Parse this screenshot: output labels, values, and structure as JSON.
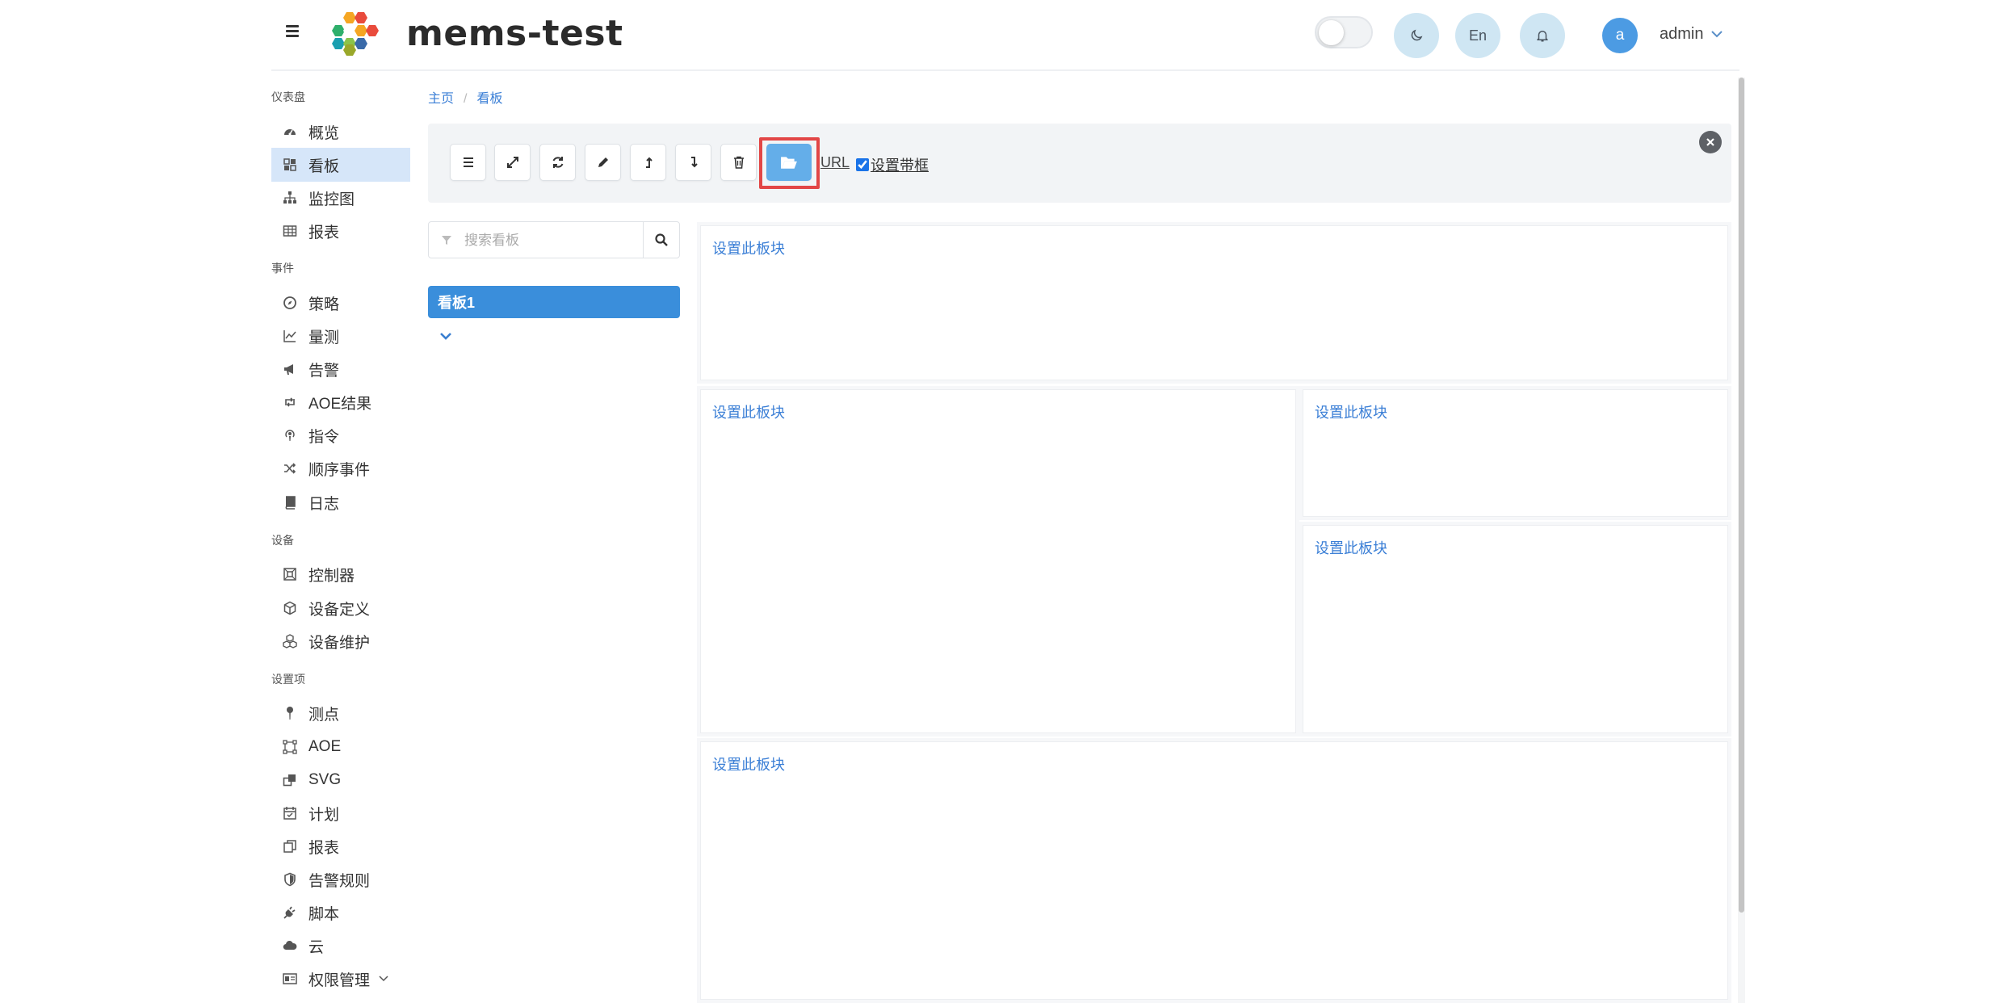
{
  "header": {
    "title": "mems-test",
    "lang_label": "En",
    "avatar_letter": "a",
    "user_name": "admin"
  },
  "sidebar": {
    "sections": [
      {
        "title": "仪表盘",
        "items": [
          {
            "label": "概览",
            "icon": "dashboard-icon"
          },
          {
            "label": "看板",
            "icon": "board-icon",
            "active": true
          },
          {
            "label": "监控图",
            "icon": "sitemap-icon"
          },
          {
            "label": "报表",
            "icon": "table-icon"
          }
        ]
      },
      {
        "title": "事件",
        "items": [
          {
            "label": "策略",
            "icon": "compass-icon"
          },
          {
            "label": "量测",
            "icon": "line-chart-icon"
          },
          {
            "label": "告警",
            "icon": "megaphone-icon"
          },
          {
            "label": "AOE结果",
            "icon": "retweet-icon"
          },
          {
            "label": "指令",
            "icon": "podcast-icon"
          },
          {
            "label": "顺序事件",
            "icon": "shuffle-icon"
          },
          {
            "label": "日志",
            "icon": "book-icon"
          }
        ]
      },
      {
        "title": "设备",
        "items": [
          {
            "label": "控制器",
            "icon": "controller-icon"
          },
          {
            "label": "设备定义",
            "icon": "cube-icon"
          },
          {
            "label": "设备维护",
            "icon": "cubes-icon"
          }
        ]
      },
      {
        "title": "设置项",
        "items": [
          {
            "label": "测点",
            "icon": "pin-icon"
          },
          {
            "label": "AOE",
            "icon": "vector-icon"
          },
          {
            "label": "SVG",
            "icon": "clone-icon"
          },
          {
            "label": "计划",
            "icon": "calendar-check-icon"
          },
          {
            "label": "报表",
            "icon": "copy-icon"
          },
          {
            "label": "告警规则",
            "icon": "shield-icon"
          },
          {
            "label": "脚本",
            "icon": "plug-icon"
          },
          {
            "label": "云",
            "icon": "cloud-icon"
          },
          {
            "label": "权限管理",
            "icon": "id-card-icon"
          }
        ]
      }
    ]
  },
  "breadcrumb": {
    "home": "主页",
    "current": "看板"
  },
  "toolbar": {
    "buttons": [
      "menu-icon",
      "expand-icon",
      "refresh-icon",
      "edit-icon",
      "upload-icon",
      "download-icon",
      "delete-icon",
      "folder-open-icon"
    ],
    "url_label": "URL",
    "frame_label": "设置带框",
    "frame_checked": true
  },
  "search": {
    "placeholder": "搜索看板",
    "value": ""
  },
  "boards": [
    {
      "label": "看板1",
      "selected": true
    }
  ],
  "blocks": {
    "block1": "设置此板块",
    "block2": "设置此板块",
    "block3": "设置此板块",
    "block4": "设置此板块",
    "block5": "设置此板块"
  },
  "colors": {
    "accent": "#3a8edb",
    "link": "#3b7fd6",
    "active_bg": "#d6e6f9",
    "highlight_border": "#e24646",
    "primary_button": "#64aee9"
  }
}
